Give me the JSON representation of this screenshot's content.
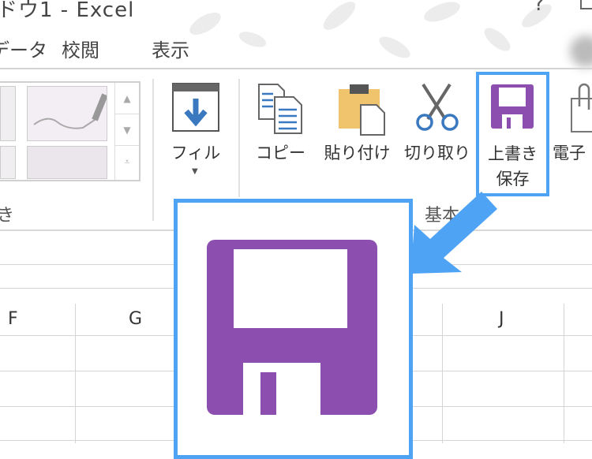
{
  "window": {
    "title": "ドウ1 - Excel",
    "help": "?"
  },
  "tabs": [
    "データ",
    "校閲",
    "表示"
  ],
  "ribbon": {
    "fill_label": "フィル",
    "copy_label": "コピー",
    "paste_label": "貼り付け",
    "cut_label": "切り取り",
    "save_label_line1": "上書き",
    "save_label_line2": "保存",
    "esign_label": "電子",
    "group_left_label": "き",
    "group_basic_label": "基本"
  },
  "columns": [
    "F",
    "G",
    "J"
  ],
  "colors": {
    "accent": "#4fa3f5",
    "save_icon": "#8c4fb0"
  }
}
